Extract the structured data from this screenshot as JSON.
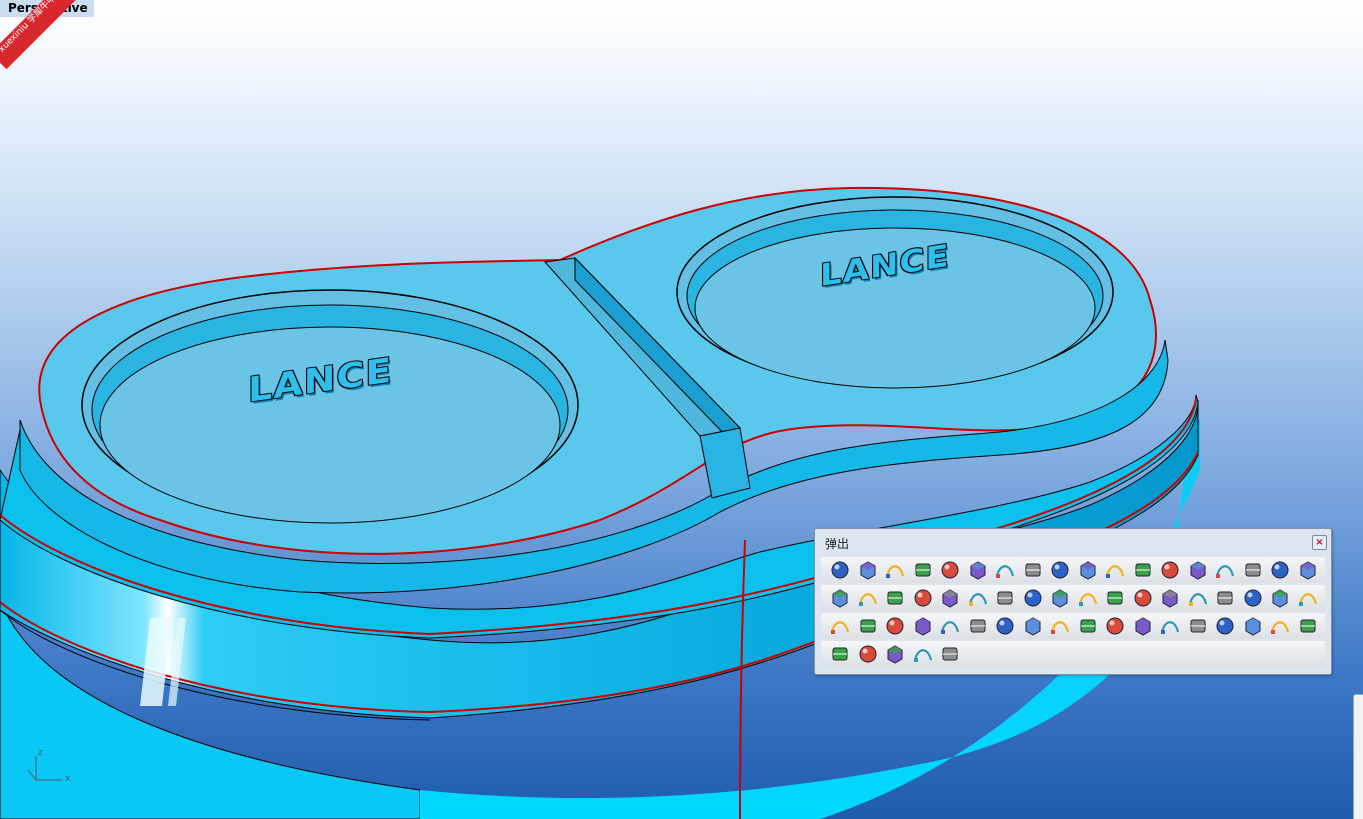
{
  "viewport": {
    "label": "Perspective",
    "watermark": "xuexiniu 学犀牛中文网",
    "axis_z": "z",
    "axis_x": "x",
    "engraving": "LANCE"
  },
  "palette": {
    "title": "弹出",
    "close_glyph": "×",
    "rows": [
      [
        "lightbulb-icon",
        "lock-icon",
        "save-icon",
        "zoom-extents-icon",
        "wireframe-sphere-icon",
        "shaded-sphere-icon",
        "color-wheel-icon",
        "gear-icon",
        "explode-icon",
        "pipe-curve-icon",
        "surface-patch-icon",
        "surface-edge-icon",
        "mesh-icon",
        "fillet-1-2-icon",
        "fillet-2-icon",
        "point-cloud-icon",
        "arc-sweep-icon",
        "revolve-icon"
      ],
      [
        "array-icon",
        "point-edit-icon",
        "align-icon",
        "surface-frame-icon",
        "polyline-icon",
        "circle-point-icon",
        "layers-icon",
        "cylinder-surface-icon",
        "plane-surface-icon",
        "plane-tilt-icon",
        "rotate-circle-icon",
        "box-icon",
        "sphere-icon",
        "spheres-icon",
        "sphere-cut-icon",
        "sphere-pair-icon",
        "curve-0-2-icon",
        "tube-icon"
      ],
      [
        "box-solid-icon",
        "curve-hook-icon",
        "curve-s-icon",
        "curve-arc-icon",
        "figure-icon",
        "polyline-2-icon",
        "stack-icon",
        "solid-rect-icon",
        "grid-icon",
        "blend-surface-icon",
        "cylinder-icon",
        "cylinder-2-icon",
        "pac-icon",
        "pac-2-icon",
        "panel-icon",
        "funnel-icon",
        "cylinder-open-icon",
        "twist-surface-icon"
      ],
      [
        "surface-fold-icon",
        "plane-surface-2-icon",
        "offset-icon",
        "sweep-x-icon",
        "book-icon"
      ]
    ]
  }
}
